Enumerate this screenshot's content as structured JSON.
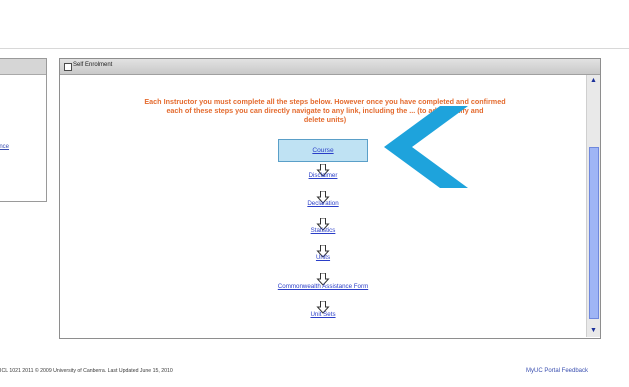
{
  "left_panel": {
    "link_text": "ance"
  },
  "main_panel": {
    "header_title": "Self Enrolment",
    "instruction_line1": "Each Instructor you must complete all the steps below. However once you have completed and confirmed",
    "instruction_line2": "each of these steps you can directly navigate to any link, including the ... (to add, modify and",
    "instruction_line3": "delete units)"
  },
  "steps": [
    {
      "label": "Course",
      "selected": true
    },
    {
      "label": "Disclaimer",
      "selected": false
    },
    {
      "label": "Declaration",
      "selected": false
    },
    {
      "label": "Statistics",
      "selected": false
    },
    {
      "label": "Units",
      "selected": false
    },
    {
      "label": "Commonwealth Assistance Form",
      "selected": false
    },
    {
      "label": "Unit Sets",
      "selected": false
    }
  ],
  "scrollbar": {
    "up_icon": "scroll-up-arrow",
    "down_icon": "scroll-down-arrow"
  },
  "footer": {
    "text": "ICL 1021 2011 © 2009 University of Canberra. Last Updated June 15, 2010",
    "feedback_link": "MyUC Portal Feedback"
  },
  "overlay": {
    "icon": "left-chevron-pointer",
    "color": "#1ea3dc"
  }
}
